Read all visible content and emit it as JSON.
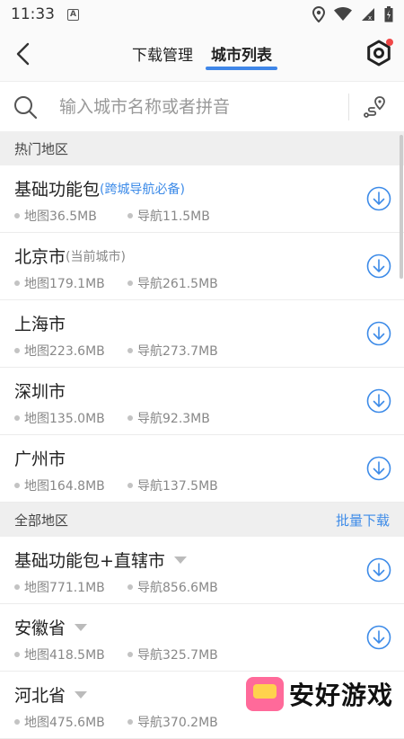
{
  "status_bar": {
    "time": "11:33",
    "badge": "A"
  },
  "nav": {
    "tabs": [
      {
        "label": "下载管理",
        "active": false
      },
      {
        "label": "城市列表",
        "active": true
      }
    ]
  },
  "search": {
    "placeholder": "输入城市名称或者拼音"
  },
  "hot_section": {
    "title": "热门地区"
  },
  "hot_cities": [
    {
      "name": "基础功能包",
      "suffix": "(跨城导航必备)",
      "map": "地图36.5MB",
      "nav": "导航11.5MB"
    },
    {
      "name": "北京市",
      "suffix": "(当前城市)",
      "map": "地图179.1MB",
      "nav": "导航261.5MB"
    },
    {
      "name": "上海市",
      "suffix": "",
      "map": "地图223.6MB",
      "nav": "导航273.7MB"
    },
    {
      "name": "深圳市",
      "suffix": "",
      "map": "地图135.0MB",
      "nav": "导航92.3MB"
    },
    {
      "name": "广州市",
      "suffix": "",
      "map": "地图164.8MB",
      "nav": "导航137.5MB"
    }
  ],
  "all_section": {
    "title": "全部地区",
    "action": "批量下载"
  },
  "all_regions": [
    {
      "name": "基础功能包+直辖市",
      "map": "地图771.1MB",
      "nav": "导航856.6MB"
    },
    {
      "name": "安徽省",
      "map": "地图418.5MB",
      "nav": "导航325.7MB"
    },
    {
      "name": "河北省",
      "map": "地图475.6MB",
      "nav": "导航370.2MB"
    }
  ],
  "watermark": {
    "text": "安好游戏"
  },
  "colors": {
    "accent": "#3d8be8",
    "notify_dot": "#f04848"
  }
}
